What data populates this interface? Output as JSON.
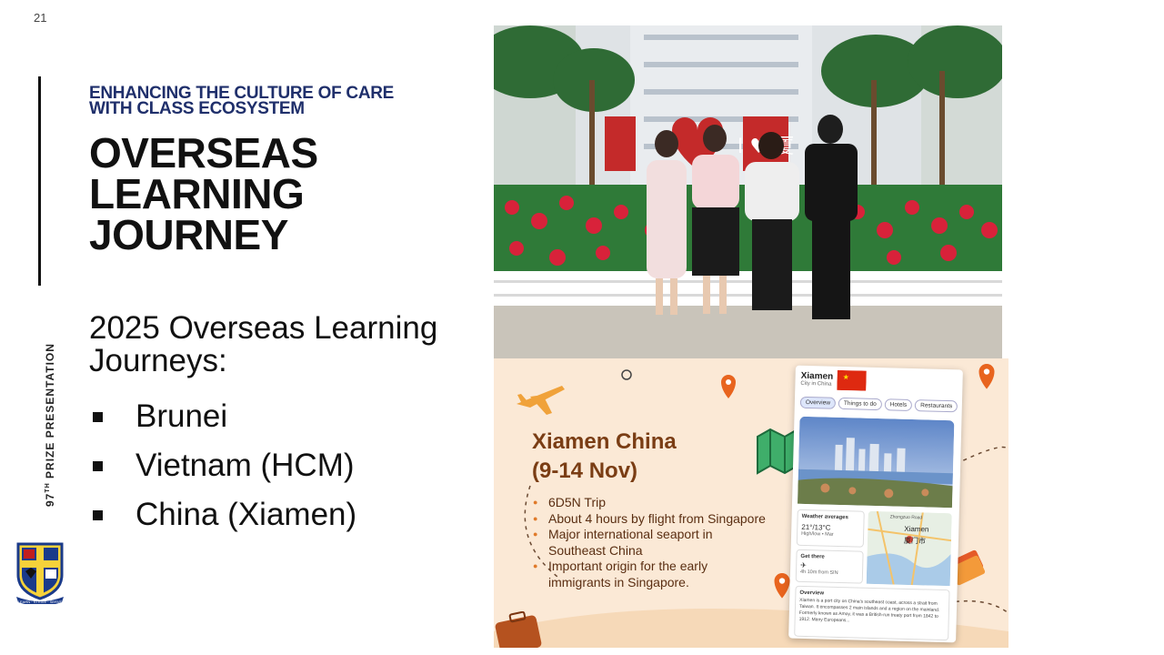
{
  "slide": {
    "page_number": "21",
    "side_label_pre": "97",
    "side_label_sup": "TH",
    "side_label_post": " PRIZE PRESENTATION",
    "subtitle": "ENHANCING THE CULTURE OF CARE WITH CLASS ECOSYSTEM",
    "title": "OVERSEAS LEARNING JOURNEY",
    "journeys_heading": "2025 Overseas Learning Journeys:",
    "journeys": [
      "Brunei",
      "Vietnam (HCM)",
      "China (Xiamen)"
    ]
  },
  "crest": {
    "school_name": "Bukit Panjang Secondary School",
    "motto": "LEARN · STRIVE · SERVE"
  },
  "photo": {
    "sign_text": "I ♥ 厦"
  },
  "poster": {
    "title_line1": "Xiamen China",
    "title_line2": "(9-14 Nov)",
    "points": [
      "6D5N Trip",
      "About 4 hours by flight from Singapore",
      "Major international seaport in Southeast China",
      "Important origin for the early immigrants in Singapore."
    ],
    "card": {
      "city": "Xiamen",
      "city_sub": "City in China",
      "tabs": [
        "Overview",
        "Things to do",
        "Hotels",
        "Restaurants"
      ],
      "weather_label": "Weather averages",
      "weather_temp": "21°/13°C",
      "weather_range": "High/low • Mar",
      "get_there_label": "Get there",
      "flight_time": "4h 10m from SIN",
      "map_label": "Xiamen",
      "map_label_cn": "厦门市",
      "map_label_2": "Zhongzuo Road",
      "overview_label": "Overview",
      "overview_text": "Xiamen is a port city on China's southeast coast, across a strait from Taiwan. It encompasses 2 main islands and a region on the mainland. Formerly known as Amoy, it was a British-run treaty port from 1842 to 1912. Many Europeans..."
    }
  },
  "colors": {
    "subtitle": "#1f2f6b",
    "poster_bg": "#fbe9d6",
    "poster_text": "#7a3d14",
    "accent_orange": "#e07a2a"
  }
}
